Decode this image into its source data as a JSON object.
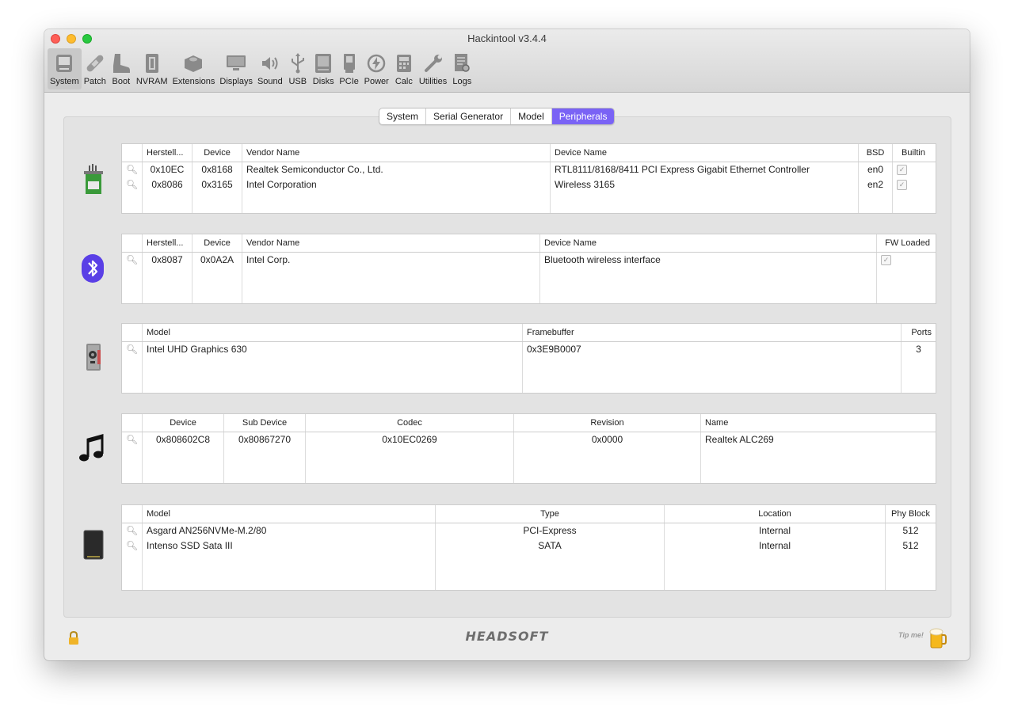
{
  "window": {
    "title": "Hackintool v3.4.4"
  },
  "toolbar": {
    "items": [
      {
        "label": "System",
        "icon": "computer-icon"
      },
      {
        "label": "Patch",
        "icon": "bandage-icon"
      },
      {
        "label": "Boot",
        "icon": "boot-icon"
      },
      {
        "label": "NVRAM",
        "icon": "nvram-icon"
      },
      {
        "label": "Extensions",
        "icon": "lego-icon"
      },
      {
        "label": "Displays",
        "icon": "display-icon"
      },
      {
        "label": "Sound",
        "icon": "speaker-icon"
      },
      {
        "label": "USB",
        "icon": "usb-icon"
      },
      {
        "label": "Disks",
        "icon": "disk-icon"
      },
      {
        "label": "PCIe",
        "icon": "pcie-icon"
      },
      {
        "label": "Power",
        "icon": "power-icon"
      },
      {
        "label": "Calc",
        "icon": "calculator-icon"
      },
      {
        "label": "Utilities",
        "icon": "wrench-icon"
      },
      {
        "label": "Logs",
        "icon": "logs-icon"
      }
    ]
  },
  "tabs": [
    "System",
    "Serial Generator",
    "Model",
    "Peripherals"
  ],
  "network": {
    "headers": [
      "Herstell...",
      "Device",
      "Vendor Name",
      "Device Name",
      "BSD",
      "Builtin"
    ],
    "rows": [
      {
        "vendor_id": "0x10EC",
        "device": "0x8168",
        "vendor_name": "Realtek Semiconductor Co., Ltd.",
        "device_name": "RTL8111/8168/8411 PCI Express Gigabit Ethernet Controller",
        "bsd": "en0"
      },
      {
        "vendor_id": "0x8086",
        "device": "0x3165",
        "vendor_name": "Intel Corporation",
        "device_name": "Wireless 3165",
        "bsd": "en2"
      }
    ]
  },
  "bluetooth": {
    "headers": [
      "Herstell...",
      "Device",
      "Vendor Name",
      "Device Name",
      "FW Loaded"
    ],
    "rows": [
      {
        "vendor_id": "0x8087",
        "device": "0x0A2A",
        "vendor_name": "Intel Corp.",
        "device_name": "Bluetooth wireless interface"
      }
    ]
  },
  "graphics": {
    "headers": [
      "Model",
      "Framebuffer",
      "Ports"
    ],
    "rows": [
      {
        "model": "Intel UHD Graphics 630",
        "framebuffer": "0x3E9B0007",
        "ports": "3"
      }
    ]
  },
  "audio": {
    "headers": [
      "Device",
      "Sub Device",
      "Codec",
      "Revision",
      "Name"
    ],
    "rows": [
      {
        "device": "0x808602C8",
        "sub_device": "0x80867270",
        "codec": "0x10EC0269",
        "revision": "0x0000",
        "name": "Realtek ALC269"
      }
    ]
  },
  "storage": {
    "headers": [
      "Model",
      "Type",
      "Location",
      "Phy Block"
    ],
    "rows": [
      {
        "model": "Asgard AN256NVMe-M.2/80",
        "type": "PCI-Express",
        "location": "Internal",
        "phy_block": "512"
      },
      {
        "model": "Intenso SSD Sata III",
        "type": "SATA",
        "location": "Internal",
        "phy_block": "512"
      }
    ]
  },
  "footer": {
    "brand": "HEADSOFT",
    "tip": "Tip me!"
  },
  "colors": {
    "accent": "#7a63f5"
  }
}
